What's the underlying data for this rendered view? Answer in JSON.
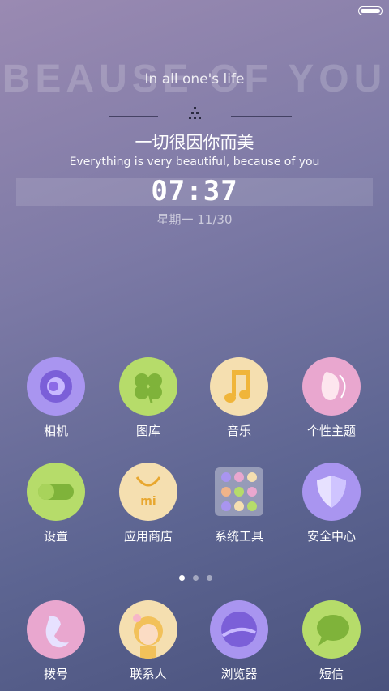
{
  "status": {
    "battery_icon": "battery-icon"
  },
  "widget": {
    "bg_text": "BEAUSE OF YOU",
    "overlay_text": "In all one's life",
    "title_cn": "一切很因你而美",
    "subtitle_en": "Everything is very beautiful, because of you",
    "time": "07:37",
    "date": "星期一  11/30"
  },
  "apps_row1": [
    {
      "label": "相机",
      "icon": "camera-icon",
      "color": "#a995f0"
    },
    {
      "label": "图库",
      "icon": "clover-gallery-icon",
      "color": "#b6dc6a"
    },
    {
      "label": "音乐",
      "icon": "music-note-icon",
      "color": "#f5dfb0"
    },
    {
      "label": "个性主题",
      "icon": "theme-icon",
      "color": "#e9a7cf"
    }
  ],
  "apps_row2": [
    {
      "label": "设置",
      "icon": "toggle-settings-icon",
      "color": "#b6dc6a"
    },
    {
      "label": "应用商店",
      "icon": "shopping-bag-icon",
      "color": "#f5dfb0"
    },
    {
      "label": "系统工具",
      "icon": "tools-folder-icon",
      "color": "#c9bfe0"
    },
    {
      "label": "安全中心",
      "icon": "shield-icon",
      "color": "#a995f0"
    }
  ],
  "page_indicator": {
    "count": 3,
    "active": 1
  },
  "dock": [
    {
      "label": "拨号",
      "icon": "phone-icon",
      "color": "#e9a7cf"
    },
    {
      "label": "联系人",
      "icon": "contact-girl-icon",
      "color": "#f5dfb0"
    },
    {
      "label": "浏览器",
      "icon": "browser-icon",
      "color": "#a995f0"
    },
    {
      "label": "短信",
      "icon": "message-bubble-icon",
      "color": "#b6dc6a"
    }
  ]
}
